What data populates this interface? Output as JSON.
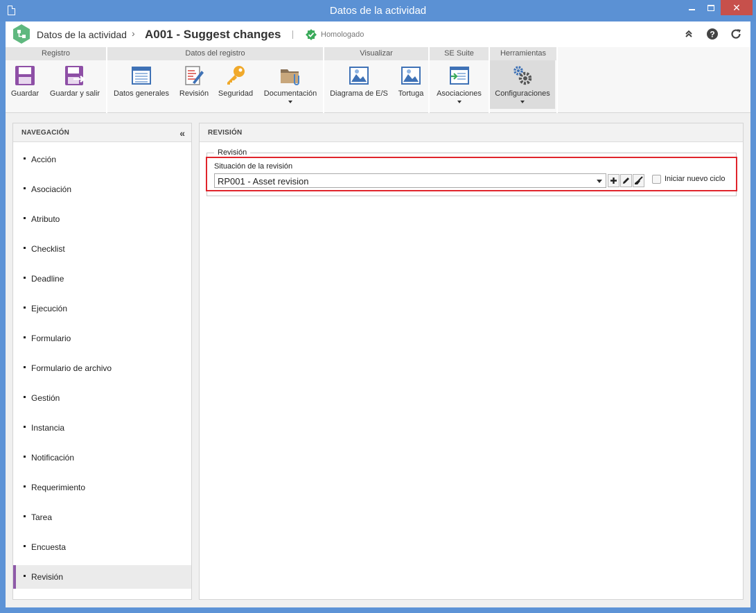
{
  "window": {
    "title": "Datos de la actividad"
  },
  "header": {
    "breadcrumb_root": "Datos de la actividad",
    "breadcrumb_sep": "›",
    "record_title": "A001 - Suggest changes",
    "status_text": "Homologado"
  },
  "ribbon": {
    "groups": {
      "registro": "Registro",
      "datos_registro": "Datos del registro",
      "visualizar": "Visualizar",
      "se_suite": "SE Suite",
      "herramientas": "Herramientas"
    },
    "buttons": {
      "guardar": "Guardar",
      "guardar_salir": "Guardar y salir",
      "datos_generales": "Datos generales",
      "revision": "Revisión",
      "seguridad": "Seguridad",
      "documentacion": "Documentación",
      "diagrama": "Diagrama de E/S",
      "tortuga": "Tortuga",
      "asociaciones": "Asociaciones",
      "configuraciones": "Configuraciones"
    }
  },
  "nav": {
    "title": "NAVEGACIÓN",
    "items": [
      "Acción",
      "Asociación",
      "Atributo",
      "Checklist",
      "Deadline",
      "Ejecución",
      "Formulario",
      "Formulario de archivo",
      "Gestión",
      "Instancia",
      "Notificación",
      "Requerimiento",
      "Tarea",
      "Encuesta",
      "Revisión"
    ],
    "selected_index": 14
  },
  "main": {
    "title": "REVISIÓN",
    "fieldset_legend": "Revisión",
    "field_label": "Situación de la revisión",
    "select_value": "RP001 - Asset revision",
    "checkbox_label": "Iniciar nuevo ciclo",
    "checkbox_checked": false
  },
  "colors": {
    "titlebar": "#5b91d4",
    "close_button": "#c7504b",
    "accent_purple": "#8e5aa8",
    "highlight_red": "#e0242b",
    "status_green": "#3aaa5a"
  }
}
